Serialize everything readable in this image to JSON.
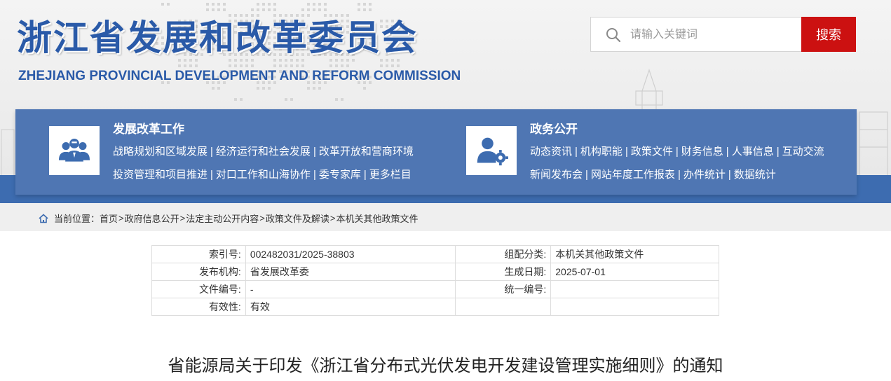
{
  "site": {
    "title_cn": "浙江省发展和改革委员会",
    "title_en": "ZHEJIANG PROVINCIAL DEVELOPMENT AND REFORM COMMISSION"
  },
  "search": {
    "placeholder": "请输入关键词",
    "button_label": "搜索",
    "icon": "search-icon"
  },
  "nav": {
    "left": {
      "title": "发展改革工作",
      "icon": "people-group-icon",
      "row1": [
        "战略规划和区域发展",
        "经济运行和社会发展",
        "改革开放和营商环境"
      ],
      "row2": [
        "投资管理和项目推进",
        "对口工作和山海协作",
        "委专家库",
        "更多栏目"
      ]
    },
    "right": {
      "title": "政务公开",
      "icon": "user-settings-icon",
      "row1": [
        "动态资讯",
        "机构职能",
        "政策文件",
        "财务信息",
        "人事信息",
        "互动交流"
      ],
      "row2": [
        "新闻发布会",
        "网站年度工作报表",
        "办件统计",
        "数据统计"
      ]
    },
    "separator": "|"
  },
  "breadcrumb": {
    "prefix": "当前位置：",
    "items": [
      "首页",
      "政府信息公开",
      "法定主动公开内容",
      "政策文件及解读",
      "本机关其他政策文件"
    ],
    "separator": ">"
  },
  "meta": {
    "rows": [
      {
        "label1": "索引号:",
        "value1": "002482031/2025-38803",
        "label2": "组配分类:",
        "value2": "本机关其他政策文件"
      },
      {
        "label1": "发布机构:",
        "value1": "省发展改革委",
        "label2": "生成日期:",
        "value2": "2025-07-01"
      },
      {
        "label1": "文件编号:",
        "value1": "-",
        "label2": "统一编号:",
        "value2": ""
      },
      {
        "label1": "有效性:",
        "value1": "有效",
        "label2": "",
        "value2": ""
      }
    ]
  },
  "document": {
    "title": "省能源局关于印发《浙江省分布式光伏发电开发建设管理实施细则》的通知"
  },
  "colors": {
    "brand_blue": "#2a5aa8",
    "nav_blue": "#4f76b3",
    "search_red": "#cc1111"
  }
}
